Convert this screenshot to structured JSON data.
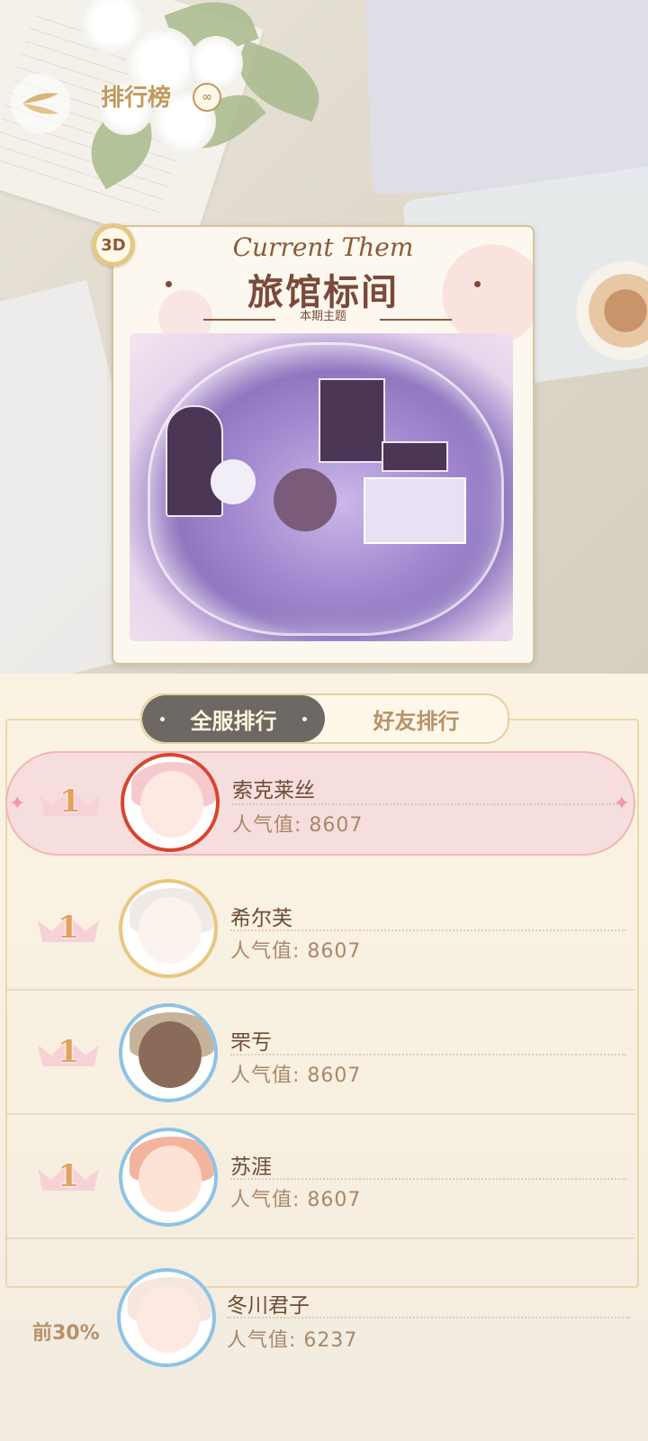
{
  "header": {
    "title": "排行榜",
    "info_icon": "infinity-icon"
  },
  "theme": {
    "badge_3d": "3D",
    "script_title": "Current Them",
    "name": "旅馆标间",
    "subtitle": "本期主题"
  },
  "tabs": [
    {
      "label": "全服排行",
      "active": true
    },
    {
      "label": "好友排行",
      "active": false
    }
  ],
  "rankings": [
    {
      "rank": "1",
      "name": "索克莱丝",
      "score_label": "人气值:",
      "score": "8607"
    },
    {
      "rank": "1",
      "name": "希尔芙",
      "score_label": "人气值:",
      "score": "8607"
    },
    {
      "rank": "1",
      "name": "罘亐",
      "score_label": "人气值:",
      "score": "8607"
    },
    {
      "rank": "1",
      "name": "苏涯",
      "score_label": "人气值:",
      "score": "8607"
    }
  ],
  "me": {
    "rank_text": "前30%",
    "name": "冬川君子",
    "score_label": "人气值:",
    "score": "6237"
  },
  "colors": {
    "accent_gold": "#c09a5c",
    "highlight_row": "#f7dede",
    "tab_active": "#6e6864",
    "name_text": "#6f4c37"
  }
}
